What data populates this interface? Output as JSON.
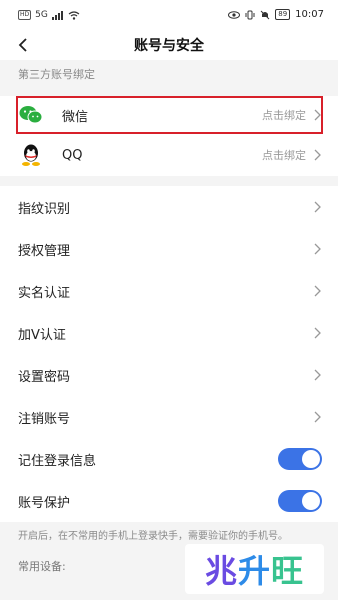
{
  "status_bar": {
    "network": "HD",
    "signal": "5G",
    "battery": "89",
    "time": "10:07"
  },
  "nav": {
    "title": "账号与安全"
  },
  "third_party": {
    "header": "第三方账号绑定",
    "items": [
      {
        "label": "微信",
        "hint": "点击绑定",
        "icon": "wechat-icon",
        "color": "#2aae3f"
      },
      {
        "label": "QQ",
        "hint": "点击绑定",
        "icon": "qq-icon",
        "color": "#111111"
      }
    ]
  },
  "settings": {
    "items": [
      {
        "label": "指纹识别"
      },
      {
        "label": "授权管理"
      },
      {
        "label": "实名认证"
      },
      {
        "label": "加V认证"
      },
      {
        "label": "设置密码"
      },
      {
        "label": "注销账号"
      }
    ],
    "toggles": [
      {
        "label": "记住登录信息",
        "on": true
      },
      {
        "label": "账号保护",
        "on": true
      }
    ],
    "note": "开启后，在不常用的手机上登录快手，需要验证你的手机号。"
  },
  "devices": {
    "header": "常用设备:"
  },
  "watermark": {
    "part1": "兆",
    "part2": "升",
    "part3": "旺"
  },
  "colors": {
    "accent": "#3b73e6",
    "highlight": "#d8202a"
  }
}
